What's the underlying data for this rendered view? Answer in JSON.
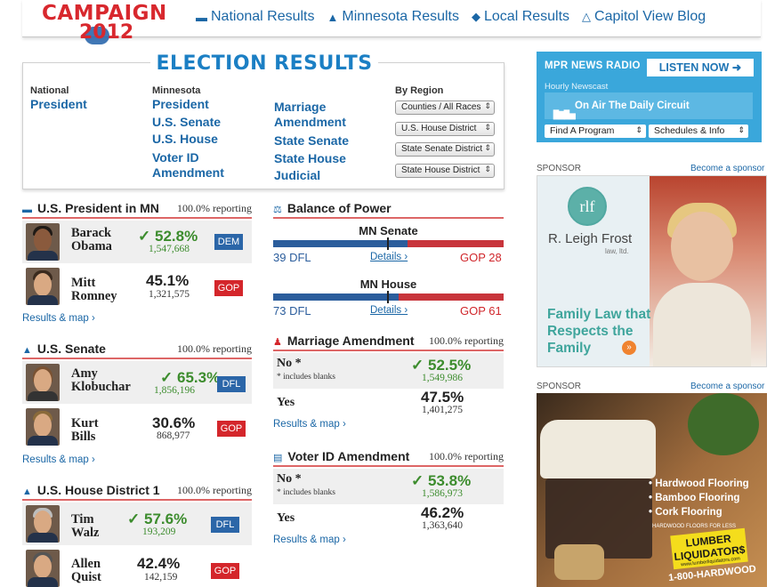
{
  "header": {
    "logo_top": "CAMPAIGN",
    "logo_bottom": "2012",
    "nav": [
      {
        "label": "National Results",
        "icon": "us-map-icon"
      },
      {
        "label": "Minnesota Results",
        "icon": "mn-map-icon"
      },
      {
        "label": "Local Results",
        "icon": "location-icon"
      },
      {
        "label": "Capitol View Blog",
        "icon": "capitol-icon"
      }
    ]
  },
  "results": {
    "title": "ELECTION RESULTS",
    "national": {
      "heading": "National",
      "links": [
        "President"
      ]
    },
    "minnesota": {
      "heading": "Minnesota",
      "links": [
        "President",
        "U.S. Senate",
        "U.S. House",
        "Voter ID Amendment"
      ]
    },
    "mn_more": {
      "links": [
        "Marriage Amendment",
        "State Senate",
        "State House",
        "Judicial"
      ]
    },
    "region": {
      "heading": "By Region",
      "selects": [
        "Counties / All Races",
        "U.S. House District",
        "State Senate District",
        "State House District"
      ]
    }
  },
  "president": {
    "title": "U.S. President in MN",
    "reporting": "100.0% reporting",
    "candidates": [
      {
        "first": "Barack",
        "last": "Obama",
        "pct": "52.8%",
        "votes": "1,547,668",
        "party": "DEM",
        "winner": true,
        "check": "✓"
      },
      {
        "first": "Mitt",
        "last": "Romney",
        "pct": "45.1%",
        "votes": "1,321,575",
        "party": "GOP",
        "winner": false
      }
    ],
    "link": "Results & map ›"
  },
  "senate": {
    "title": "U.S. Senate",
    "reporting": "100.0% reporting",
    "candidates": [
      {
        "first": "Amy",
        "last": "Klobuchar",
        "pct": "65.3%",
        "votes": "1,856,196",
        "party": "DFL",
        "winner": true,
        "check": "✓"
      },
      {
        "first": "Kurt",
        "last": "Bills",
        "pct": "30.6%",
        "votes": "868,977",
        "party": "GOP",
        "winner": false
      }
    ],
    "link": "Results & map ›"
  },
  "house": {
    "title": "U.S. House District 1",
    "reporting": "100.0% reporting",
    "candidates": [
      {
        "first": "Tim",
        "last": "Walz",
        "pct": "57.6%",
        "votes": "193,209",
        "party": "DFL",
        "winner": true,
        "check": "✓"
      },
      {
        "first": "Allen",
        "last": "Quist",
        "pct": "42.4%",
        "votes": "142,159",
        "party": "GOP",
        "winner": false
      }
    ]
  },
  "balance": {
    "title": "Balance of Power",
    "chambers": [
      {
        "name": "MN Senate",
        "dfl_label": "39 DFL",
        "dfl": 39,
        "gop_label": "GOP 28",
        "gop": 28,
        "details": "Details ›"
      },
      {
        "name": "MN House",
        "dfl_label": "73 DFL",
        "dfl": 73,
        "gop_label": "GOP 61",
        "gop": 61,
        "details": "Details ›"
      }
    ]
  },
  "marriage": {
    "title": "Marriage Amendment",
    "reporting": "100.0% reporting",
    "options": [
      {
        "label": "No *",
        "note": "* includes blanks",
        "pct": "52.5%",
        "votes": "1,549,986",
        "winner": true,
        "check": "✓"
      },
      {
        "label": "Yes",
        "note": "",
        "pct": "47.5%",
        "votes": "1,401,275",
        "winner": false
      }
    ],
    "link": "Results & map ›"
  },
  "voterid": {
    "title": "Voter ID Amendment",
    "reporting": "100.0% reporting",
    "options": [
      {
        "label": "No *",
        "note": "* includes blanks",
        "pct": "53.8%",
        "votes": "1,586,973",
        "winner": true,
        "check": "✓"
      },
      {
        "label": "Yes",
        "note": "",
        "pct": "46.2%",
        "votes": "1,363,640",
        "winner": false
      }
    ],
    "link": "Results & map ›"
  },
  "radio": {
    "title": "MPR NEWS RADIO",
    "listen": "LISTEN NOW",
    "hourly": "Hourly Newscast",
    "onair": "On Air The Daily Circuit",
    "find": "Find A Program",
    "schedules": "Schedules & Info"
  },
  "sponsors": {
    "label": "SPONSOR",
    "become": "Become a sponsor",
    "ad1": {
      "mark": "rlf",
      "firm": "R. Leigh Frost",
      "firm_sub": "law, ltd.",
      "tagline": "Family Law that Respects the Family"
    },
    "ad2": {
      "features": [
        "Hardwood Flooring",
        "Bamboo Flooring",
        "Cork Flooring"
      ],
      "small": "HARDWOOD FLOORS FOR LESS",
      "name": "LUMBER LIQUIDATOR$",
      "url": "www.lumberliquidators.com",
      "phone": "1-800-HARDWOOD"
    }
  },
  "colors": {
    "blue": "#1b67a6",
    "red": "#d4262b",
    "green": "#3c8c2d",
    "radio": "#3aa7db"
  }
}
